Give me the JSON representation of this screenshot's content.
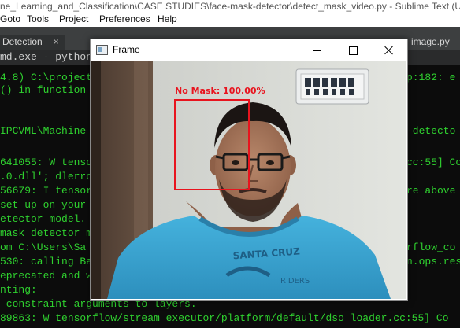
{
  "app": {
    "title": "ne_Learning_and_Classification\\CASE STUDIES\\face-mask-detector\\detect_mask_video.py - Sublime Text (UNR"
  },
  "menu": {
    "items": [
      "Goto",
      "Tools",
      "Project",
      "Preferences",
      "Help"
    ]
  },
  "tabs": [
    {
      "label": "Detection",
      "close": "×"
    },
    {
      "label": "image.py",
      "close": "×"
    }
  ],
  "cmdbar": {
    "text": "md.exe - python  det"
  },
  "terminal": {
    "lines": [
      {
        "left": "4.8) C:\\project",
        "right": "p:182: e"
      },
      {
        "left": "() in function",
        "right": ""
      },
      {
        "left": "",
        "right": ""
      },
      {
        "left": "IPCVML\\Machine_",
        "right": "-detecto"
      },
      {
        "left": "",
        "right": ""
      },
      {
        "left": "641055: W tensor",
        "right": "cc:55] Co"
      },
      {
        "left": ".0.dll'; dlerro",
        "right": ""
      },
      {
        "left": "56679: I tensor",
        "right": "re above"
      },
      {
        "left": "set up on your",
        "right": ""
      },
      {
        "left": "etector model.",
        "right": ""
      },
      {
        "left": "mask detector m",
        "right": ""
      },
      {
        "left": "om C:\\Users\\Sa",
        "right": "rflow_co"
      },
      {
        "left": "530: calling Ba",
        "right": "n.ops.res"
      },
      {
        "left": "eprecated and w",
        "right": ""
      },
      {
        "left": "nting:",
        "right": ""
      },
      {
        "left": "_constraint arguments to layers.",
        "right": ""
      },
      {
        "left": "89863: W tensorflow/stream_executor/platform/default/dso_loader.cc:55] Co",
        "right": ""
      }
    ]
  },
  "frame_window": {
    "title": "Frame",
    "detection_label": "No Mask: 100.00%",
    "box_color": "#e8141e",
    "shirt_text_top": "SANTA CRUZ",
    "shirt_text_bottom": "RIDERS"
  },
  "colors": {
    "terminal_text": "#2fd12f",
    "terminal_bg": "#0c0c0c",
    "tab_bar": "#3d3f40",
    "wall": "#d9dbd6",
    "shirt": "#3aa7d2",
    "door": "#5a4436"
  }
}
